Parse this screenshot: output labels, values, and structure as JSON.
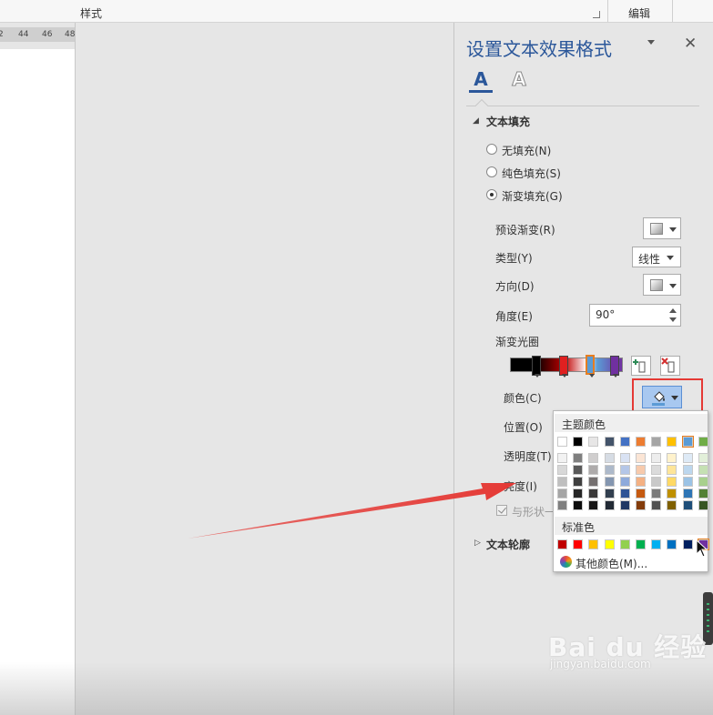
{
  "ribbon": {
    "styles_group": "样式",
    "editing_group": "编辑"
  },
  "ruler": {
    "ticks": [
      "2",
      "44",
      "46",
      "48"
    ]
  },
  "pane": {
    "title": "设置文本效果格式",
    "tabs": [
      {
        "glyph": "A",
        "icon": "text-fill-outline-tab"
      },
      {
        "glyph": "A",
        "icon": "text-effects-tab"
      }
    ],
    "text_fill": {
      "header": "文本填充",
      "options": [
        "无填充(N)",
        "纯色填充(S)",
        "渐变填充(G)"
      ],
      "selected": "渐变填充(G)",
      "preset_label": "预设渐变(R)",
      "type_label": "类型(Y)",
      "type_value": "线性",
      "direction_label": "方向(D)",
      "angle_label": "角度(E)",
      "angle_value": "90°",
      "stops_label": "渐变光圈",
      "color_label": "颜色(C)",
      "position_label": "位置(O)",
      "transparency_label": "透明度(T)",
      "brightness_label": "亮度(I)",
      "rotate_label": "与形状一"
    },
    "text_outline": {
      "header": "文本轮廓"
    }
  },
  "color_picker": {
    "theme_header": "主题颜色",
    "standard_header": "标准色",
    "more_colors": "其他颜色(M)...",
    "theme_top": [
      "#ffffff",
      "#000000",
      "#e7e6e6",
      "#44546a",
      "#4472c4",
      "#ed7d31",
      "#a5a5a5",
      "#ffc000",
      "#5b9bd5",
      "#70ad47"
    ],
    "theme_tints": [
      [
        "#f2f2f2",
        "#7f7f7f",
        "#d0cece",
        "#d6dce4",
        "#d9e2f3",
        "#fbe5d5",
        "#ededed",
        "#fff2cc",
        "#deeaf6",
        "#e2efd9"
      ],
      [
        "#d8d8d8",
        "#595959",
        "#aeabab",
        "#adb9ca",
        "#b4c6e7",
        "#f7caac",
        "#dbdbdb",
        "#fee599",
        "#bdd7ee",
        "#c5e0b3"
      ],
      [
        "#bfbfbf",
        "#3f3f3f",
        "#757070",
        "#8496b0",
        "#8eaadb",
        "#f4b183",
        "#c9c9c9",
        "#ffd965",
        "#9cc3e5",
        "#a8d08d"
      ],
      [
        "#a5a5a5",
        "#262626",
        "#3a3838",
        "#323f4f",
        "#2f5496",
        "#c55a11",
        "#7b7b7b",
        "#bf9000",
        "#2e75b5",
        "#538135"
      ],
      [
        "#7f7f7f",
        "#0c0c0c",
        "#171616",
        "#222a35",
        "#1f3864",
        "#833c0b",
        "#525252",
        "#7f6000",
        "#1e4e79",
        "#375623"
      ]
    ],
    "standard": [
      "#c00000",
      "#ff0000",
      "#ffc000",
      "#ffff00",
      "#92d050",
      "#00b050",
      "#00b0f0",
      "#0070c0",
      "#002060",
      "#7030a0"
    ]
  },
  "watermark": {
    "brand": "Bai du 经验",
    "url": "jingyan.baidu.com"
  }
}
